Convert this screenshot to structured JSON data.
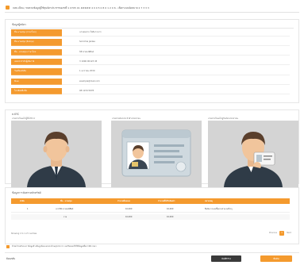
{
  "header": {
    "title": "ลงทะเบียน / ทบทวนข้อมูลผู้ใช้ทุนบัตรประชาชนเลขที่ 1 0705 01 ##### 4 0 0 5 0 8 0 1 2 0 6 - เลือกระบบนัดหมาย 2 7 3 3 3"
  },
  "profile": {
    "section_title": "ข้อมูลผู้สมัคร",
    "rows": [
      {
        "label": "ชื่อ-นามสกุล (ภาษาไทย)",
        "value": "นายสมชาย ใจดีมากมาก"
      },
      {
        "label": "ชื่อ-นามสกุล (อังกฤษ)",
        "value": "Somchai Jaidee"
      },
      {
        "label": "ชื่อ - นามสกุล ภาษาไทย",
        "value": "นิติ ชาดมณีศิษย์"
      },
      {
        "label": "เลขประจำตัวผู้เสียภาษี",
        "value": "3 1006 00123 45"
      },
      {
        "label": "วันเดือนปีเกิด",
        "value": "1 มกราคม 2530"
      },
      {
        "label": "อีเมล",
        "value": "example@mail.com"
      },
      {
        "label": "โทรศัพท์มือถือ",
        "value": "08 1234 5678"
      }
    ]
  },
  "ekyc": {
    "section_title": "e-KYC",
    "captions": [
      "ภาพถ่ายใบหน้าผู้ใช้บริการ",
      "ภาพถ่ายบัตรประจำตัวประชาชน",
      "ภาพถ่ายใบหน้าคู่กับบัตรประชาชน"
    ]
  },
  "table": {
    "section_title": "ข้อมูลการจัดสรรหลักทรัพย์",
    "headers": [
      "ลำดับ",
      "ชื่อ - นามสกุล",
      "จำนวนที่ขอจอง",
      "จำนวนที่ได้รับจัดสรร",
      "หมายเหตุ"
    ],
    "rows": [
      {
        "no": "1",
        "name": "นายวิชัย ชาดมณีศิษย์",
        "req": "10,000",
        "alloc": "10,000",
        "note": "ยืนยันการจองซื้อตามจำนวนที่ระบุ"
      }
    ],
    "total": {
      "label": "รวม",
      "req": "10,000",
      "alloc": "10,000"
    },
    "footer_text": "Showing 1 to 1 of 1 entries",
    "pager": {
      "prev": "Previous",
      "page": "1",
      "next": "Next"
    }
  },
  "consent": {
    "text": "ข้าพเจ้าขอรับรองว่าข้อมูลข้างต้นถูกต้องและครบถ้วนทุกประการ และยินยอมให้ใช้ข้อมูลเพื่อการพิจารณา"
  },
  "footer": {
    "back_label": "ย้อนกลับ",
    "draft_label": "บันทึกร่าง",
    "submit_label": "ยืนยัน"
  },
  "colors": {
    "accent": "#f49a2e",
    "button_dark": "#3a3a3a",
    "photo_bg": "#d4d4d4"
  }
}
